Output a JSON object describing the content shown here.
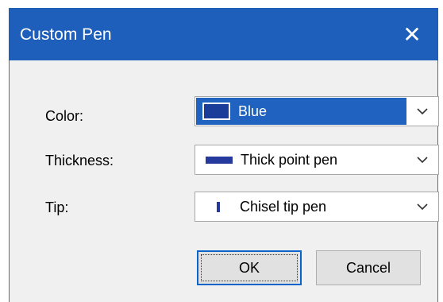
{
  "window": {
    "title": "Custom Pen",
    "close_glyph": "✕",
    "titlebar_color": "#1e5fbb"
  },
  "fields": [
    {
      "label": "Color:",
      "value": "Blue",
      "swatch": "blue-color-swatch"
    },
    {
      "label": "Thickness:",
      "value": "Thick point pen",
      "swatch": "thick-line-swatch"
    },
    {
      "label": "Tip:",
      "value": "Chisel tip pen",
      "swatch": "chisel-tip-swatch"
    }
  ],
  "buttons": {
    "ok": "OK",
    "cancel": "Cancel"
  },
  "colors": {
    "accent": "#1f62bf",
    "pen_blue": "#253a9c"
  }
}
